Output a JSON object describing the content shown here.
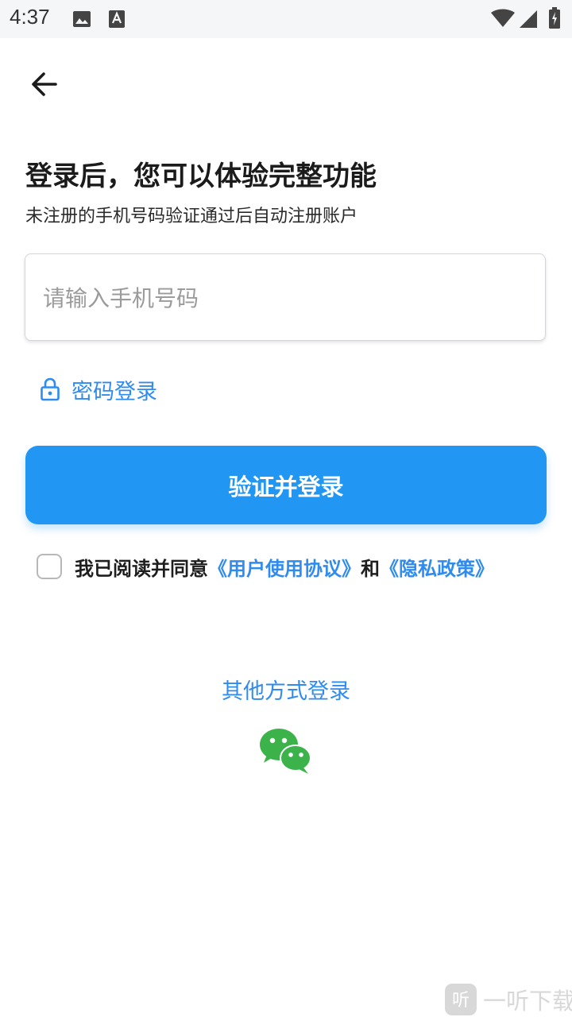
{
  "status_bar": {
    "time": "4:37",
    "icons": [
      "image-icon",
      "font-a-icon",
      "wifi-icon",
      "signal-icon",
      "battery-icon"
    ]
  },
  "nav": {
    "back_icon": "arrow-left-icon"
  },
  "header": {
    "title": "登录后，您可以体验完整功能",
    "subtitle": "未注册的手机号码验证通过后自动注册账户"
  },
  "phone_input": {
    "placeholder": "请输入手机号码",
    "value": ""
  },
  "password_login": {
    "icon": "lock-icon",
    "label": "密码登录"
  },
  "verify_button": {
    "label": "验证并登录",
    "color": "#2196f3"
  },
  "agreement": {
    "checked": false,
    "prefix": "我已阅读并同意",
    "user_agreement_link": "《用户使用协议》",
    "conjunction": "和",
    "privacy_link": "《隐私政策》"
  },
  "other_login": {
    "label": "其他方式登录",
    "wechat_icon": "wechat-icon",
    "wechat_color": "#3bb34a"
  },
  "colors": {
    "accent": "#2f8bee",
    "background": "#ffffff"
  },
  "watermark": {
    "text": "一听下载"
  }
}
